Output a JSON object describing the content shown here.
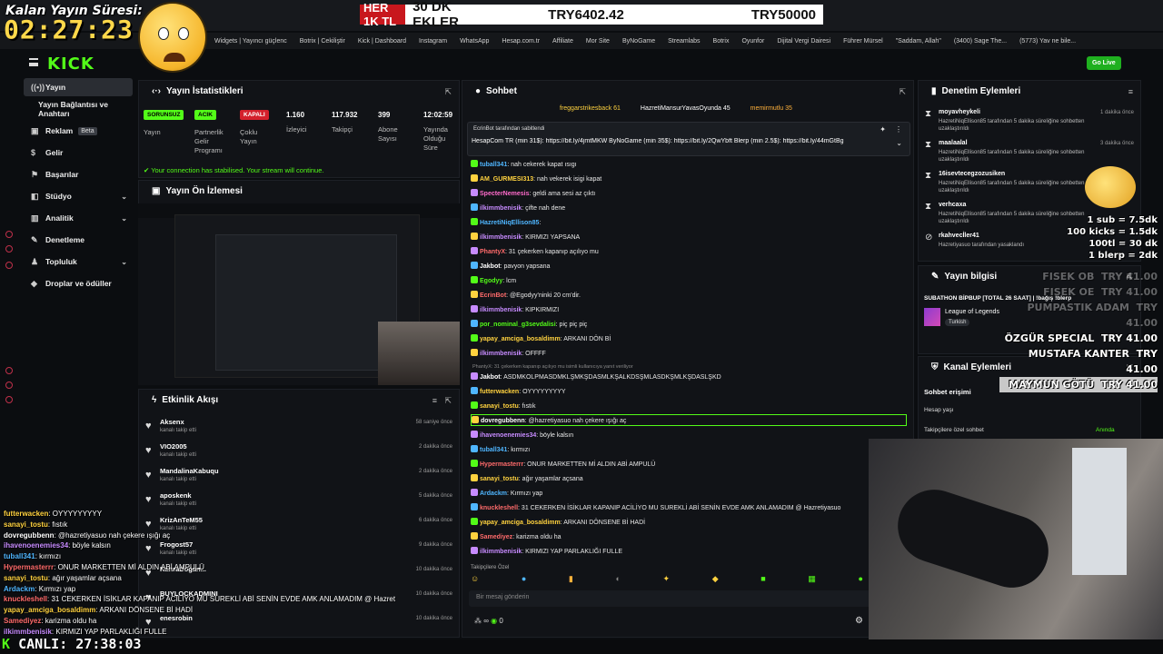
{
  "overlay": {
    "title": "Kalan Yayın Süresi:",
    "timer": "02:27:23",
    "live_label": "CANLI:",
    "live_timer": "27:38:03",
    "live_k": "K"
  },
  "ticker": {
    "highlight": "HER 1K TL",
    "t1": "30 DK EKLER",
    "t2": "TRY6402.42",
    "t3": "TRY50000"
  },
  "bookmarks": [
    "Widgets | Yayıncı güçlenc",
    "Botrix | Cekiliştir",
    "Kick | Dashboard",
    "Instagram",
    "WhatsApp",
    "Hesap.com.tr",
    "Affiliate",
    "Mor Site",
    "ByNoGame",
    "Streamlabs",
    "Botrix",
    "Oyunfor",
    "Dijital Vergi Dairesi",
    "Führer Mürsel",
    "\"Saddam, Allah\"",
    "(3400) Sage The...",
    "(5773) Yav ne bile..."
  ],
  "golive": "Go Live",
  "logo": "KICK",
  "sidebar": {
    "items": [
      {
        "label": "Yayın",
        "icon": "((•))"
      },
      {
        "label": "Yayın Bağlantısı ve Anahtarı",
        "icon": ""
      },
      {
        "label": "Reklam",
        "icon": "▣",
        "badge": "Beta"
      },
      {
        "label": "Gelir",
        "icon": "$"
      },
      {
        "label": "Başarılar",
        "icon": "⚑"
      },
      {
        "label": "Stüdyo",
        "icon": "◧"
      },
      {
        "label": "Analitik",
        "icon": "▥"
      },
      {
        "label": "Denetleme",
        "icon": "✎"
      },
      {
        "label": "Topluluk",
        "icon": "♟"
      },
      {
        "label": "Droplar ve ödüller",
        "icon": "◆"
      }
    ]
  },
  "stats_panel": {
    "title": "Yayın İstatistikleri",
    "badges": [
      {
        "label": "SORUNSUZ",
        "bg": "#53fc18",
        "fg": "#000"
      },
      {
        "label": "ACIK",
        "bg": "#53fc18",
        "fg": "#000"
      },
      {
        "label": "KAPALI",
        "bg": "#d4202c",
        "fg": "#fff"
      }
    ],
    "stat_labels": [
      "Yayın",
      "Partnerlik\nGelir\nProgramı",
      "Çoklu\nYayın",
      "İzleyici",
      "Takipçi",
      "Abone\nSayısı",
      "Yayında\nOlduğu\nSüre"
    ],
    "stat_values": [
      "1.160",
      "117.932",
      "399",
      "12:02:59"
    ],
    "stabilised": "Your connection has stabilised. Your stream will continue."
  },
  "preview_panel": {
    "title": "Yayın Ön İzlemesi"
  },
  "activity_panel": {
    "title": "Etkinlik Akışı",
    "rows": [
      {
        "name": "Aksenx",
        "sub": "kanalı takip etti",
        "time": "58 saniye önce"
      },
      {
        "name": "VIO2005",
        "sub": "kanalı takip etti",
        "time": "2 dakika önce"
      },
      {
        "name": "MandalinaKabuqu",
        "sub": "kanalı takip etti",
        "time": "2 dakika önce"
      },
      {
        "name": "aposkenk",
        "sub": "kanalı takip etti",
        "time": "5 dakika önce"
      },
      {
        "name": "KrizAnTeM55",
        "sub": "kanalı takip etti",
        "time": "6 dakika önce"
      },
      {
        "name": "Frogost57",
        "sub": "kanalı takip etti",
        "time": "9 dakika önce"
      },
      {
        "name": "KahraDoğan...",
        "sub": "",
        "time": "10 dakika önce"
      },
      {
        "name": "BUYLOCKADMINI",
        "sub": "",
        "time": "10 dakika önce"
      },
      {
        "name": "enesrobin",
        "sub": "",
        "time": "10 dakika önce"
      }
    ]
  },
  "chat_panel": {
    "title": "Sohbet",
    "gifters": [
      "freggarstrikesback 61",
      "HazretiMansurYavasOyunda 45",
      "memirmutlu 35"
    ],
    "pinned_by": "EcrinBot tarafından sabitlendi",
    "pinned_msg": "HesapCom TR (min 31$): https://bit.ly/4jmtMKW ByNoGame (min 35$): https://bit.ly/2QwYbft Blerp (min 2.5$): https://bit.ly/44mGtBg",
    "lines": [
      {
        "u": "tuball341",
        "c": "#4fb6ff",
        "m": ": nah cekerek kapat ısıgı"
      },
      {
        "u": "AM_GURMESI313",
        "c": "#ffd23f",
        "m": ": nah vekerek isigi kapat"
      },
      {
        "u": "SpecterNemesis",
        "c": "#ff6bcb",
        "m": ": geldi ama sesi az çıktı"
      },
      {
        "u": "ilkimmbenisik",
        "c": "#c78bff",
        "m": ": çifte nah dene"
      },
      {
        "u": "HazretiNiqEllison85",
        "c": "#4fb6ff",
        "m": ":"
      },
      {
        "u": "ilkimmbenisik",
        "c": "#c78bff",
        "m": ": KIRMIZI YAPSANA"
      },
      {
        "u": "PhantyX",
        "c": "#ff6b6b",
        "m": ": 31 çekerken kapanıp açılıyo mu"
      },
      {
        "u": "Jakbot",
        "c": "#ffffff",
        "m": ": pavyon yapsana"
      },
      {
        "u": "Egodyy",
        "c": "#53fc18",
        "m": ": lcm"
      },
      {
        "u": "EcrinBot",
        "c": "#ff6b6b",
        "m": ": @Egodyy'ninki 20 cm'dir."
      },
      {
        "u": "ilkimmbenisik",
        "c": "#c78bff",
        "m": ": KIPKIRMIZI"
      },
      {
        "u": "por_nominal_g3sevdalisi",
        "c": "#53fc18",
        "m": ": piç piç piç"
      },
      {
        "u": "yapay_amciga_bosaldimm",
        "c": "#ffd23f",
        "m": ": ARKANI DÖN Bİ"
      },
      {
        "u": "ilkimmbenisik",
        "c": "#c78bff",
        "m": ": OFFFF"
      },
      {
        "u": "Jakbot",
        "c": "#ffffff",
        "m": ": ASDMKOLPMASDMKLŞMKŞDASMLKŞALKDSŞMLASDKŞMLKŞDASLŞKD"
      },
      {
        "u": "futterwacken",
        "c": "#ffd23f",
        "m": ": OYYYYYYYYY"
      },
      {
        "u": "sanayi_tostu",
        "c": "#ffd23f",
        "m": ": fıstık"
      },
      {
        "u": "dovregubbenn",
        "c": "#ffffff",
        "m": ": @hazretiyasuo nah çekere ışığı aç"
      },
      {
        "u": "ihavenoenemies34",
        "c": "#c78bff",
        "m": ": böyle kalsın"
      },
      {
        "u": "tuball341",
        "c": "#4fb6ff",
        "m": ": kırmızı"
      },
      {
        "u": "Hypermasterrr",
        "c": "#ff6b6b",
        "m": ": ONUR MARKETTEN Mİ ALDIN ABİ AMPULÜ"
      },
      {
        "u": "sanayi_tostu",
        "c": "#ffd23f",
        "m": ": ağır yaşamlar açsana"
      },
      {
        "u": "Ardackm",
        "c": "#4fb6ff",
        "m": ": Kırmızı yap"
      },
      {
        "u": "knuckleshell",
        "c": "#ff6b6b",
        "m": ": 31 CEKERKEN İSİKLAR KAPANIP ACİLİYO MU SUREKLİ ABİ SENİN EVDE AMK ANLAMADIM @ Hazretiyasuo"
      },
      {
        "u": "yapay_amciga_bosaldimm",
        "c": "#ffd23f",
        "m": ": ARKANI DÖNSENE Bİ HADİ"
      },
      {
        "u": "Samediyez",
        "c": "#ff6b6b",
        "m": ": karizma oldu ha"
      },
      {
        "u": "ilkimmbenisik",
        "c": "#c78bff",
        "m": ": KIRMIZI YAP PARLAKLIĞI FULLE"
      }
    ],
    "phanty_note": "PhantyX: 31 çekerken kapanıp açılıyo mu isimli kullanıcıya yanıt veriliyor",
    "followers_only": "Takipçilere Özel",
    "input_placeholder": "Bir mesaj gönderin",
    "counter": "0"
  },
  "moderation_panel": {
    "title": "Denetim Eylemleri",
    "rows": [
      {
        "name": "moyavheykeli",
        "action": "HazretiNiqEllison85 tarafından 5 dakika süreliğine sohbetten uzaklaştırıldı",
        "time": "1 dakika önce"
      },
      {
        "name": "maalaalal",
        "action": "HazretiNiqEllison85 tarafından 5 dakika süreliğine sohbetten uzaklaştırıldı",
        "time": "3 dakika önce"
      },
      {
        "name": "16isevtecegzozusiken",
        "action": "HazretiNiqEllison85 tarafından 5 dakika süreliğine sohbetten uzaklaştırıldı",
        "time": ""
      },
      {
        "name": "verhcaxa",
        "action": "HazretiNiqEllison85 tarafından 5 dakika süreliğine sohbetten uzaklaştırıldı",
        "time": ""
      },
      {
        "name": "rkahvecİler41",
        "action": "Hazretiyasuo tarafından yasaklandı",
        "time": ""
      }
    ]
  },
  "stream_info": {
    "title": "Yayın bilgisi",
    "stream_title": "SUBATHON BİPBUP [TOTAL 26 SAAT] | !bağış !blerp",
    "game": "League of Legends",
    "tag": "Turkish"
  },
  "channel_actions": {
    "title": "Kanal Eylemleri",
    "section": "Sohbet erişimi",
    "r1": "Hesap yaşı",
    "r2": "Takipçilere özel sohbet",
    "r2_val": "Anında"
  },
  "rates": [
    "1 sub = 7.5dk",
    "100 kicks = 1.5dk",
    "100tl = 30 dk",
    "1 blerp = 2dk"
  ],
  "donations": [
    {
      "name": "FISEK OB",
      "amount": "TRY 41.00"
    },
    {
      "name": "FISEK OE",
      "amount": "TRY 41.00"
    },
    {
      "name": "PUMPASTIK ADAM",
      "amount": "TRY 41.00"
    },
    {
      "name": "ÖZGÜR SPECIAL",
      "amount": "TRY 41.00"
    },
    {
      "name": "MUSTAFA KANTER",
      "amount": "TRY 41.00"
    },
    {
      "name": "MAYMUN GÖTÜ",
      "amount": "TRY 41.00"
    }
  ],
  "overlay_chat": [
    {
      "u": "futterwacken",
      "m": ": OYYYYYYYYY"
    },
    {
      "u": "sanayi_tostu",
      "m": ": fıstık"
    },
    {
      "u": "dovregubbenn",
      "m": ": @hazretiyasuo nah çekere ışığı aç"
    },
    {
      "u": "ihavenoenemies34",
      "m": ": böyle kalsın"
    },
    {
      "u": "tuball341",
      "m": ": kırmızı"
    },
    {
      "u": "Hypermasterrr",
      "m": ": ONUR MARKETTEN Mİ ALDIN ABİ AMPULÜ"
    },
    {
      "u": "sanayi_tostu",
      "m": ": ağır yaşamlar açsana"
    },
    {
      "u": "Ardackm",
      "m": ": Kırmızı yap"
    },
    {
      "u": "knuckleshell",
      "m": ": 31 CEKERKEN İSİKLAR KAPANIP ACİLİYO MU SUREKLİ ABİ SENİN EVDE AMK ANLAMADIM @ Hazret"
    },
    {
      "u": "yapay_amciga_bosaldimm",
      "m": ": ARKANI DÖNSENE Bİ HADİ"
    },
    {
      "u": "Samediyez",
      "m": ": karizma oldu ha"
    },
    {
      "u": "ilkimmbenisik",
      "m": ": KIRMIZI YAP PARLAKLIĞI FULLE"
    }
  ],
  "colors": {
    "accent": "#53fc18",
    "danger": "#d4202c",
    "panel": "#111317"
  }
}
